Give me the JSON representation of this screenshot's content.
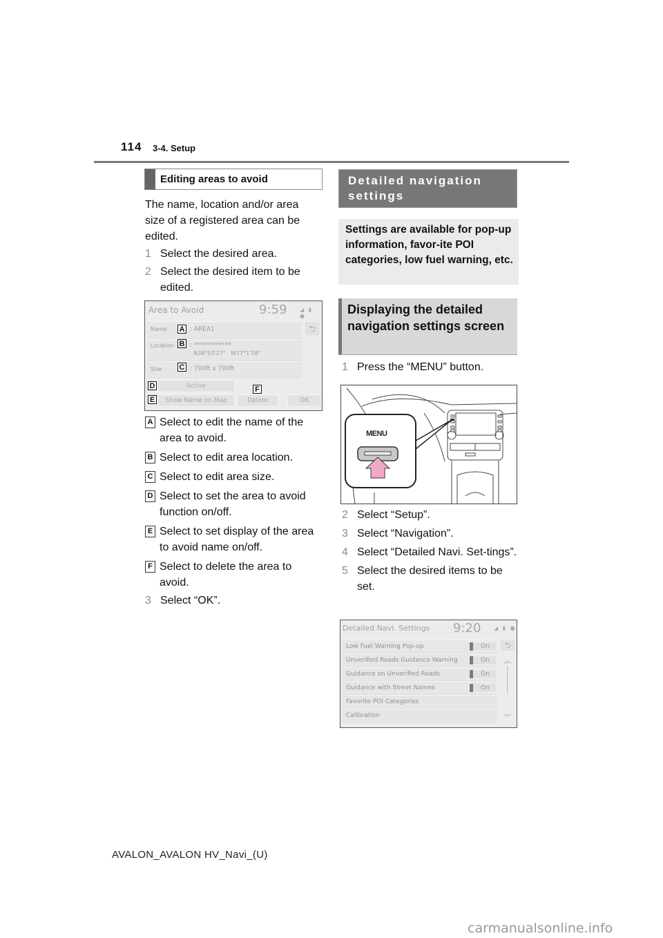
{
  "header": {
    "page_number": "114",
    "section": "3-4. Setup"
  },
  "left": {
    "heading": "Editing areas to avoid",
    "intro": "The name, location and/or area size of a registered area can be edited.",
    "steps_before": [
      {
        "num": "1",
        "text": "Select the desired area."
      },
      {
        "num": "2",
        "text": "Select the desired item to be edited."
      }
    ],
    "screen": {
      "title": "Area to Avoid",
      "clock": "9:59",
      "status_icons": "signal-icon lock-icon info-icon",
      "rows": [
        {
          "label": "Name",
          "callout": "A",
          "value": ": AREA1"
        },
        {
          "label": "Location",
          "callout": "B",
          "value": ": ************",
          "value2": "N38°53'27\"   W77°1'18\""
        },
        {
          "label": "Size",
          "callout": "C",
          "value": ": 700ft x 700ft"
        }
      ],
      "buttons": {
        "active": "Active",
        "show_name": "Show Name on Map",
        "delete": "Delete",
        "ok": "OK"
      },
      "callouts": {
        "D": "D",
        "E": "E",
        "F": "F"
      }
    },
    "legend": [
      {
        "key": "A",
        "text": "Select to edit the name of the area to avoid."
      },
      {
        "key": "B",
        "text": "Select to edit area location."
      },
      {
        "key": "C",
        "text": "Select to edit area size."
      },
      {
        "key": "D",
        "text": "Select to set the area to avoid function on/off."
      },
      {
        "key": "E",
        "text": "Select to set display of the area to avoid name on/off."
      },
      {
        "key": "F",
        "text": "Select to delete the area to avoid."
      }
    ],
    "step_after": {
      "num": "3",
      "text": "Select “OK”."
    }
  },
  "right": {
    "heading": "Detailed navigation settings",
    "intro": "Settings are available for pop-up information, favor-ite POI categories, low fuel warning, etc.",
    "subheading": "Displaying the detailed navigation settings screen",
    "step1": {
      "num": "1",
      "text": "Press the “MENU” button."
    },
    "illustration": {
      "button_label": "MENU",
      "accent": "#f2a8c8"
    },
    "steps": [
      {
        "num": "2",
        "text": "Select “Setup”."
      },
      {
        "num": "3",
        "text": "Select “Navigation”."
      },
      {
        "num": "4",
        "text": "Select “Detailed Navi. Set-tings”."
      },
      {
        "num": "5",
        "text": "Select the desired items to be set."
      }
    ],
    "screen": {
      "title": "Detailed Navi. Settings",
      "clock": "9:20",
      "rows": [
        {
          "label": "Low Fuel Warning Pop-up",
          "toggle": "On"
        },
        {
          "label": "Unverified Roads Guidance Warning",
          "toggle": "On"
        },
        {
          "label": "Guidance on Unverified Roads",
          "toggle": "On"
        },
        {
          "label": "Guidance with Street Names",
          "toggle": "On"
        },
        {
          "label": "Favorite POI Categories"
        },
        {
          "label": "Calibration"
        }
      ]
    }
  },
  "footer": {
    "code": "AVALON_AVALON HV_Navi_(U)",
    "watermark": "carmanualsonline.info"
  }
}
